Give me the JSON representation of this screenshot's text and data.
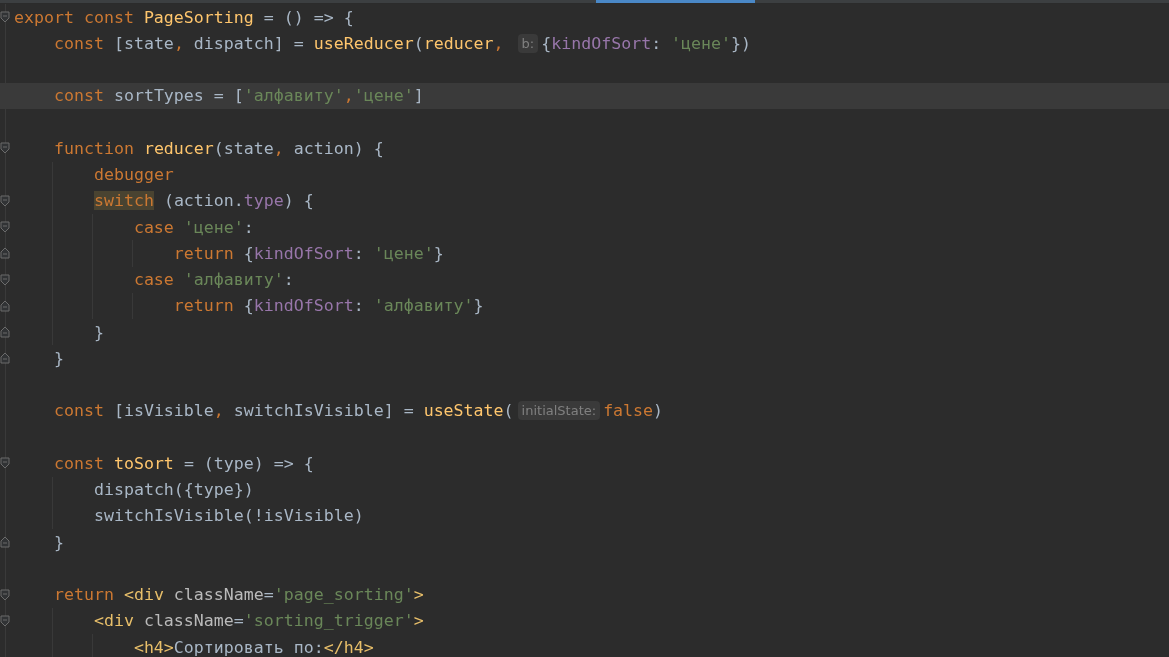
{
  "editor": {
    "lines": [
      {
        "current": false,
        "fold_open": true,
        "fold_close": false,
        "segments": [
          {
            "kind": "code",
            "tokens": [
              {
                "kind": "keyword",
                "text": "export const "
              },
              {
                "kind": "function",
                "text": "PageSorting"
              },
              {
                "kind": "plain",
                "text": " = () => {"
              }
            ]
          }
        ]
      },
      {
        "current": false,
        "fold_open": false,
        "fold_close": false,
        "segments": [
          {
            "kind": "code",
            "tokens": [
              {
                "kind": "keyword",
                "text": "    const "
              },
              {
                "kind": "plain",
                "text": "[state"
              },
              {
                "kind": "keyword",
                "text": ", "
              },
              {
                "kind": "plain",
                "text": "dispatch] = "
              },
              {
                "kind": "function",
                "text": "useReducer"
              },
              {
                "kind": "plain",
                "text": "("
              },
              {
                "kind": "function",
                "text": "reducer"
              },
              {
                "kind": "keyword",
                "text": ", "
              }
            ]
          },
          {
            "kind": "hint",
            "text": "b:"
          },
          {
            "kind": "code",
            "tokens": [
              {
                "kind": "plain",
                "text": "{"
              },
              {
                "kind": "property",
                "text": "kindOfSort"
              },
              {
                "kind": "plain",
                "text": ": "
              },
              {
                "kind": "string",
                "text": "'цене'"
              },
              {
                "kind": "plain",
                "text": "})"
              }
            ]
          }
        ]
      },
      {
        "current": false,
        "fold_open": false,
        "fold_close": false
      },
      {
        "current": true,
        "fold_open": false,
        "fold_close": false,
        "segments": [
          {
            "kind": "code",
            "tokens": [
              {
                "kind": "keyword",
                "text": "    const "
              },
              {
                "kind": "plain",
                "text": "sortTypes = ["
              },
              {
                "kind": "string",
                "text": "'алфавиту'"
              },
              {
                "kind": "keyword",
                "text": ","
              },
              {
                "kind": "string",
                "text": "'цене'"
              },
              {
                "kind": "plain",
                "text": "]"
              }
            ]
          }
        ]
      },
      {
        "current": false,
        "fold_open": false,
        "fold_close": false
      },
      {
        "current": false,
        "fold_open": true,
        "fold_close": false,
        "segments": [
          {
            "kind": "code",
            "tokens": [
              {
                "kind": "keyword",
                "text": "    function "
              },
              {
                "kind": "function",
                "text": "reducer"
              },
              {
                "kind": "plain",
                "text": "(state"
              },
              {
                "kind": "keyword",
                "text": ", "
              },
              {
                "kind": "plain",
                "text": "action) {"
              }
            ]
          }
        ]
      },
      {
        "current": false,
        "fold_open": false,
        "fold_close": false,
        "segments": [
          {
            "kind": "code",
            "tokens": [
              {
                "kind": "keyword",
                "text": "        debugger"
              }
            ]
          }
        ]
      },
      {
        "current": false,
        "fold_open": true,
        "fold_close": false,
        "segments": [
          {
            "kind": "code",
            "tokens": [
              {
                "kind": "match",
                "text": "        switch"
              },
              {
                "kind": "plain",
                "text": " (action."
              },
              {
                "kind": "property",
                "text": "type"
              },
              {
                "kind": "plain",
                "text": ") {"
              }
            ]
          }
        ]
      },
      {
        "current": false,
        "fold_open": true,
        "fold_close": false,
        "segments": [
          {
            "kind": "code",
            "tokens": [
              {
                "kind": "keyword",
                "text": "            case "
              },
              {
                "kind": "string",
                "text": "'цене'"
              },
              {
                "kind": "plain",
                "text": ":"
              }
            ]
          }
        ]
      },
      {
        "current": false,
        "fold_open": false,
        "fold_close": true,
        "segments": [
          {
            "kind": "code",
            "tokens": [
              {
                "kind": "keyword",
                "text": "                return "
              },
              {
                "kind": "plain",
                "text": "{"
              },
              {
                "kind": "property",
                "text": "kindOfSort"
              },
              {
                "kind": "plain",
                "text": ": "
              },
              {
                "kind": "string",
                "text": "'цене'"
              },
              {
                "kind": "plain",
                "text": "}"
              }
            ]
          }
        ]
      },
      {
        "current": false,
        "fold_open": true,
        "fold_close": false,
        "segments": [
          {
            "kind": "code",
            "tokens": [
              {
                "kind": "keyword",
                "text": "            case "
              },
              {
                "kind": "string",
                "text": "'алфавиту'"
              },
              {
                "kind": "plain",
                "text": ":"
              }
            ]
          }
        ]
      },
      {
        "current": false,
        "fold_open": false,
        "fold_close": true,
        "segments": [
          {
            "kind": "code",
            "tokens": [
              {
                "kind": "keyword",
                "text": "                return "
              },
              {
                "kind": "plain",
                "text": "{"
              },
              {
                "kind": "property",
                "text": "kindOfSort"
              },
              {
                "kind": "plain",
                "text": ": "
              },
              {
                "kind": "string",
                "text": "'алфавиту'"
              },
              {
                "kind": "plain",
                "text": "}"
              }
            ]
          }
        ]
      },
      {
        "current": false,
        "fold_open": false,
        "fold_close": true,
        "segments": [
          {
            "kind": "code",
            "tokens": [
              {
                "kind": "plain",
                "text": "        }"
              }
            ]
          }
        ]
      },
      {
        "current": false,
        "fold_open": false,
        "fold_close": true,
        "segments": [
          {
            "kind": "code",
            "tokens": [
              {
                "kind": "plain",
                "text": "    }"
              }
            ]
          }
        ]
      },
      {
        "current": false,
        "fold_open": false,
        "fold_close": false
      },
      {
        "current": false,
        "fold_open": false,
        "fold_close": false,
        "segments": [
          {
            "kind": "code",
            "tokens": [
              {
                "kind": "keyword",
                "text": "    const "
              },
              {
                "kind": "plain",
                "text": "[isVisible"
              },
              {
                "kind": "keyword",
                "text": ", "
              },
              {
                "kind": "plain",
                "text": "switchIsVisible] = "
              },
              {
                "kind": "function",
                "text": "useState"
              },
              {
                "kind": "plain",
                "text": "("
              }
            ]
          },
          {
            "kind": "hint",
            "text": "initialState:"
          },
          {
            "kind": "code",
            "tokens": [
              {
                "kind": "keyword",
                "text": "false"
              },
              {
                "kind": "plain",
                "text": ")"
              }
            ]
          }
        ]
      },
      {
        "current": false,
        "fold_open": false,
        "fold_close": false
      },
      {
        "current": false,
        "fold_open": true,
        "fold_close": false,
        "segments": [
          {
            "kind": "code",
            "tokens": [
              {
                "kind": "keyword",
                "text": "    const "
              },
              {
                "kind": "function",
                "text": "toSort"
              },
              {
                "kind": "plain",
                "text": " = (type) => {"
              }
            ]
          }
        ]
      },
      {
        "current": false,
        "fold_open": false,
        "fold_close": false,
        "segments": [
          {
            "kind": "code",
            "tokens": [
              {
                "kind": "plain",
                "text": "        dispatch({type})"
              }
            ]
          }
        ]
      },
      {
        "current": false,
        "fold_open": false,
        "fold_close": false,
        "segments": [
          {
            "kind": "code",
            "tokens": [
              {
                "kind": "plain",
                "text": "        switchIsVisible(!isVisible)"
              }
            ]
          }
        ]
      },
      {
        "current": false,
        "fold_open": false,
        "fold_close": true,
        "segments": [
          {
            "kind": "code",
            "tokens": [
              {
                "kind": "plain",
                "text": "    }"
              }
            ]
          }
        ]
      },
      {
        "current": false,
        "fold_open": false,
        "fold_close": false
      },
      {
        "current": false,
        "fold_open": true,
        "fold_close": false,
        "segments": [
          {
            "kind": "code",
            "tokens": [
              {
                "kind": "keyword",
                "text": "    return "
              },
              {
                "kind": "tag",
                "text": "<div "
              },
              {
                "kind": "attribute",
                "text": "className"
              },
              {
                "kind": "plain",
                "text": "="
              },
              {
                "kind": "string",
                "text": "'page_sorting'"
              },
              {
                "kind": "tag",
                "text": ">"
              }
            ]
          }
        ]
      },
      {
        "current": false,
        "fold_open": true,
        "fold_close": false,
        "segments": [
          {
            "kind": "code",
            "tokens": [
              {
                "kind": "tag",
                "text": "        <div "
              },
              {
                "kind": "attribute",
                "text": "className"
              },
              {
                "kind": "plain",
                "text": "="
              },
              {
                "kind": "string",
                "text": "'sorting_trigger'"
              },
              {
                "kind": "tag",
                "text": ">"
              }
            ]
          }
        ]
      },
      {
        "current": false,
        "fold_open": false,
        "fold_close": false,
        "segments": [
          {
            "kind": "code",
            "tokens": [
              {
                "kind": "tag",
                "text": "            <h4>"
              },
              {
                "kind": "plain",
                "text": "Сортировать по:"
              },
              {
                "kind": "tag",
                "text": "</h4>"
              }
            ]
          }
        ]
      }
    ]
  }
}
